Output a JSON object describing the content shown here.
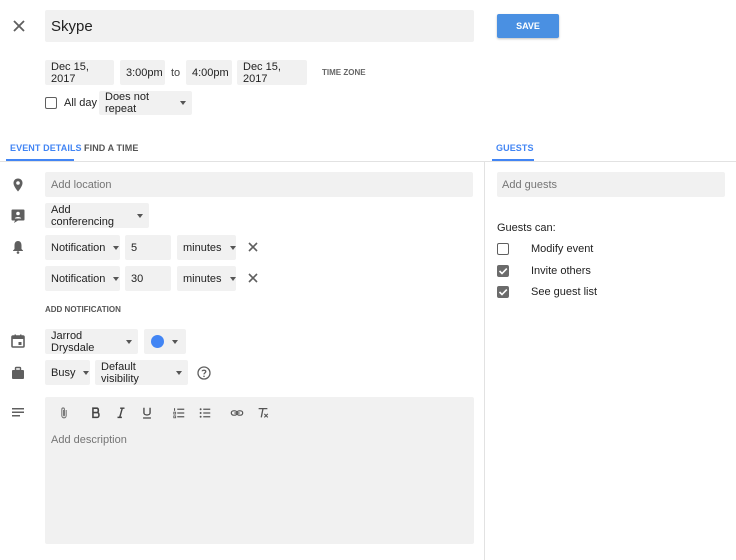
{
  "header": {
    "title": "Skype",
    "save_label": "SAVE"
  },
  "datetime": {
    "start_date": "Dec 15, 2017",
    "start_time": "3:00pm",
    "to_label": "to",
    "end_time": "4:00pm",
    "end_date": "Dec 15, 2017",
    "timezone_label": "TIME ZONE",
    "all_day_label": "All day",
    "repeat_value": "Does not repeat"
  },
  "tabs": {
    "event_details": "EVENT DETAILS",
    "find_a_time": "FIND A TIME",
    "guests": "GUESTS"
  },
  "details": {
    "location_placeholder": "Add location",
    "conferencing_value": "Add conferencing",
    "notifications": [
      {
        "type": "Notification",
        "amount": "5",
        "unit": "minutes"
      },
      {
        "type": "Notification",
        "amount": "30",
        "unit": "minutes"
      }
    ],
    "add_notification_label": "ADD NOTIFICATION",
    "calendar_owner": "Jarrod Drysdale",
    "calendar_color": "#4285f4",
    "availability": "Busy",
    "visibility": "Default visibility",
    "description_placeholder": "Add description"
  },
  "guests": {
    "add_placeholder": "Add guests",
    "permissions_title": "Guests can:",
    "permissions": [
      {
        "label": "Modify event",
        "checked": false
      },
      {
        "label": "Invite others",
        "checked": true
      },
      {
        "label": "See guest list",
        "checked": true
      }
    ]
  },
  "colors": {
    "accent": "#4285f4",
    "save_button": "#4a90e2",
    "field_bg": "#f1f1f1"
  }
}
